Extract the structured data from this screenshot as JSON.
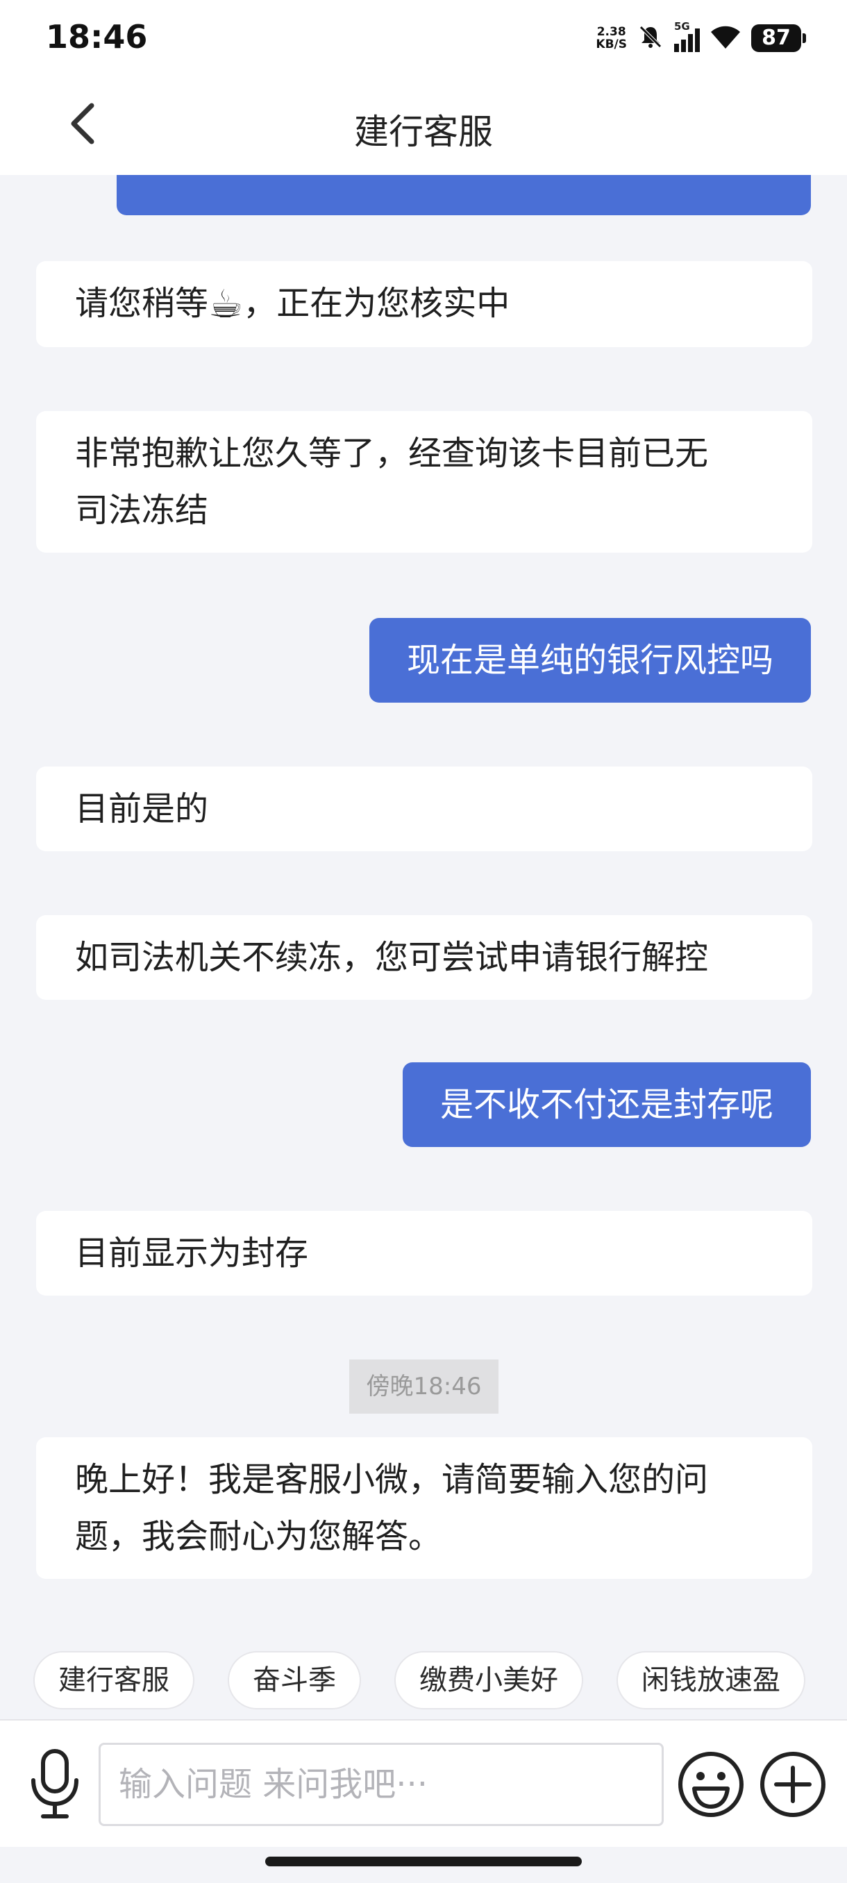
{
  "status_bar": {
    "time": "18:46",
    "net_speed_value": "2.38",
    "net_speed_unit": "KB/S",
    "signal_label": "5G",
    "battery": "87"
  },
  "nav": {
    "title": "建行客服"
  },
  "messages": [
    {
      "from": "agent",
      "text_before": "请您稍等",
      "emoji": "☕",
      "text_after": "，正在为您核实中"
    },
    {
      "from": "agent",
      "line1": "非常抱歉让您久等了，经查询该卡目前已无",
      "line2": "司法冻结"
    },
    {
      "from": "user",
      "text": "现在是单纯的银行风控吗"
    },
    {
      "from": "agent",
      "text": "目前是的"
    },
    {
      "from": "agent",
      "text": "如司法机关不续冻，您可尝试申请银行解控"
    },
    {
      "from": "user",
      "text": "是不收不付还是封存呢"
    },
    {
      "from": "agent",
      "text": "目前显示为封存"
    },
    {
      "from": "timestamp",
      "text": "傍晚18:46"
    },
    {
      "from": "agent",
      "line1": "晚上好！我是客服小微，请简要输入您的问",
      "line2": "题，我会耐心为您解答。"
    }
  ],
  "quick_replies": [
    "建行客服",
    "奋斗季",
    "缴费小美好",
    "闲钱放速盈"
  ],
  "input": {
    "placeholder": "输入问题 来问我吧···",
    "value": ""
  },
  "colors": {
    "user_bubble": "#4a6fd6",
    "background": "#f3f4f8"
  }
}
